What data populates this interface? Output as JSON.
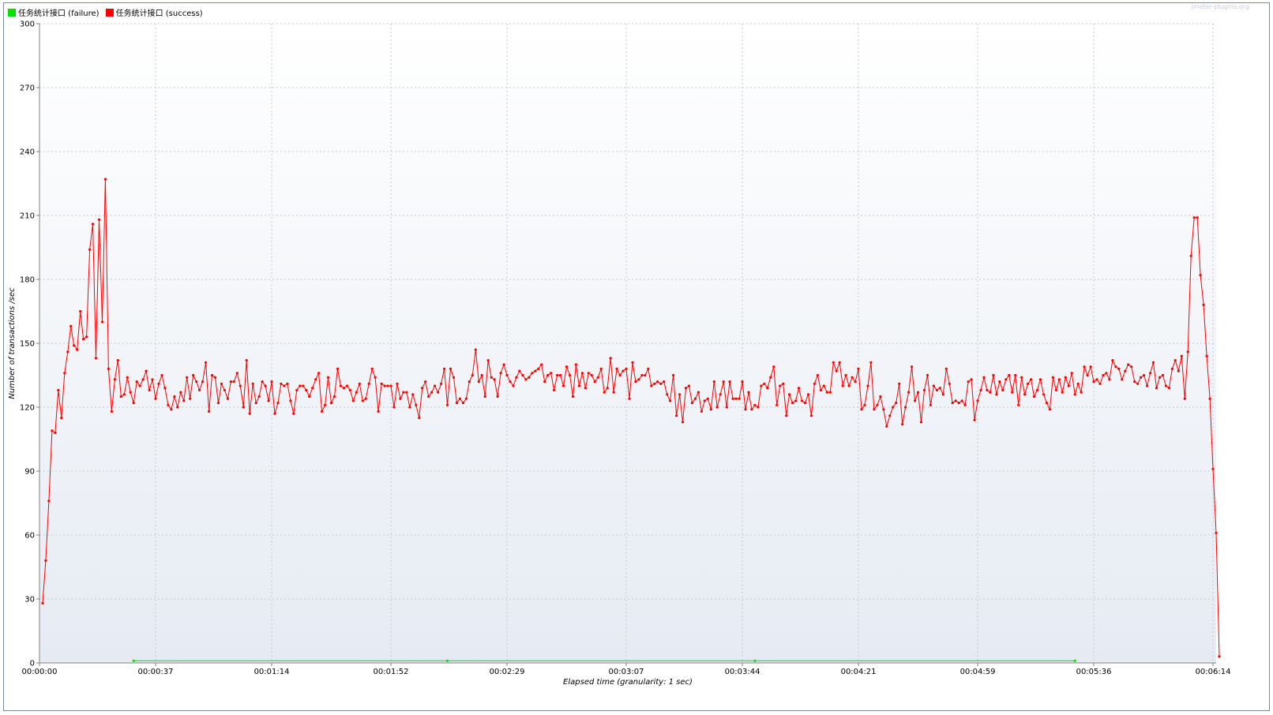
{
  "watermark": "jmeter-plugins.org",
  "legend": [
    {
      "label": "任务统计接口 (failure)",
      "color": "#00e000"
    },
    {
      "label": "任务统计接口 (success)",
      "color": "#ff0000"
    }
  ],
  "chart_data": {
    "type": "line",
    "title": "",
    "xlabel": "Elapsed time (granularity: 1 sec)",
    "ylabel": "Number of transactions /sec",
    "xlim": [
      0,
      375
    ],
    "ylim": [
      0,
      300
    ],
    "grid": true,
    "legend_position": "top-left",
    "y_ticks": [
      0,
      30,
      60,
      90,
      120,
      150,
      180,
      210,
      240,
      270,
      300
    ],
    "x_tick_seconds": [
      0,
      37,
      74,
      112,
      149,
      187,
      224,
      261,
      299,
      336,
      374
    ],
    "x_tick_labels": [
      "00:00:00",
      "00:00:37",
      "00:01:14",
      "00:01:52",
      "00:02:29",
      "00:03:07",
      "00:03:44",
      "00:04:21",
      "00:04:59",
      "00:05:36",
      "00:06:14"
    ],
    "series": [
      {
        "name": "任务统计接口 (failure)",
        "color": "#00e000",
        "x": [
          30,
          130,
          228,
          330
        ],
        "y": [
          1,
          1,
          1,
          1
        ]
      },
      {
        "name": "任务统计接口 (success)",
        "color": "#ff0000",
        "x_start": 1,
        "x_step": 1,
        "y": [
          28,
          48,
          76,
          109,
          108,
          128,
          115,
          136,
          146,
          158,
          149,
          147,
          165,
          152,
          153,
          194,
          206,
          143,
          208,
          160,
          227,
          138,
          118,
          133,
          142,
          125,
          126,
          134,
          127,
          122,
          132,
          130,
          133,
          137,
          128,
          133,
          124,
          131,
          135,
          129,
          121,
          119,
          125,
          120,
          127,
          123,
          134,
          124,
          135,
          132,
          128,
          132,
          141,
          118,
          135,
          134,
          122,
          131,
          128,
          124,
          132,
          132,
          136,
          130,
          120,
          142,
          117,
          131,
          122,
          125,
          132,
          130,
          123,
          132,
          117,
          122,
          131,
          130,
          131,
          123,
          117,
          128,
          130,
          130,
          128,
          125,
          129,
          133,
          136,
          118,
          121,
          134,
          122,
          125,
          138,
          130,
          129,
          130,
          128,
          123,
          127,
          131,
          123,
          124,
          131,
          138,
          134,
          118,
          131,
          130,
          130,
          130,
          120,
          131,
          124,
          127,
          127,
          120,
          126,
          121,
          115,
          129,
          132,
          125,
          127,
          130,
          127,
          131,
          138,
          121,
          138,
          134,
          122,
          124,
          122,
          124,
          132,
          135,
          147,
          132,
          135,
          125,
          142,
          134,
          133,
          125,
          136,
          140,
          135,
          132,
          130,
          134,
          137,
          135,
          133,
          134,
          136,
          137,
          138,
          140,
          132,
          135,
          136,
          128,
          135,
          135,
          130,
          139,
          135,
          125,
          140,
          130,
          136,
          129,
          136,
          135,
          132,
          134,
          138,
          127,
          129,
          143,
          127,
          138,
          135,
          137,
          138,
          124,
          141,
          132,
          133,
          135,
          135,
          138,
          130,
          131,
          132,
          131,
          132,
          126,
          123,
          135,
          116,
          126,
          113,
          129,
          130,
          122,
          124,
          127,
          118,
          123,
          124,
          119,
          132,
          120,
          126,
          132,
          120,
          132,
          124,
          124,
          124,
          132,
          119,
          127,
          119,
          121,
          120,
          130,
          131,
          129,
          134,
          139,
          121,
          130,
          131,
          116,
          126,
          122,
          123,
          129,
          123,
          122,
          126,
          116,
          131,
          135,
          128,
          130,
          127,
          127,
          141,
          137,
          141,
          130,
          135,
          130,
          134,
          132,
          138,
          119,
          121,
          130,
          141,
          119,
          121,
          125,
          119,
          111,
          116,
          120,
          122,
          131,
          112,
          120,
          127,
          139,
          123,
          127,
          113,
          128,
          135,
          121,
          130,
          128,
          129,
          126,
          138,
          131,
          122,
          123,
          122,
          123,
          121,
          132,
          133,
          114,
          123,
          128,
          134,
          128,
          127,
          135,
          126,
          132,
          128,
          133,
          135,
          127,
          135,
          121,
          134,
          126,
          131,
          133,
          125,
          128,
          133,
          126,
          122,
          119,
          134,
          128,
          133,
          127,
          134,
          130,
          136,
          126,
          131,
          127,
          139,
          135,
          139,
          132,
          133,
          131,
          135,
          136,
          133,
          142,
          139,
          138,
          133,
          137,
          140,
          139,
          132,
          131,
          134,
          135,
          130,
          136,
          141,
          129,
          134,
          135,
          130,
          129,
          138,
          142,
          137,
          144,
          124,
          146,
          191,
          209,
          209,
          182,
          168,
          144,
          124,
          91,
          61,
          3
        ]
      }
    ]
  }
}
